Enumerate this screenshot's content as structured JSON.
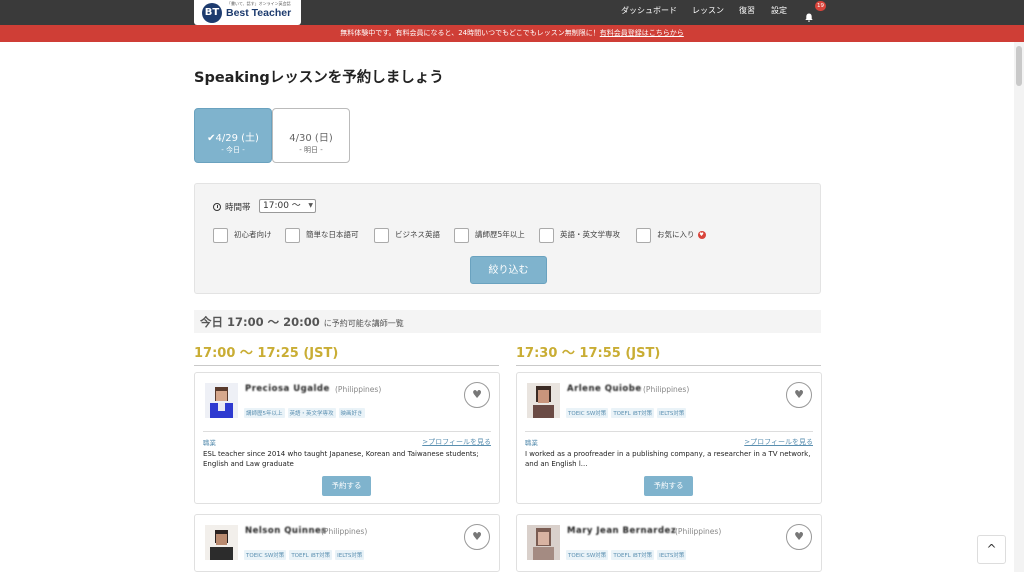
{
  "header": {
    "logo_tagline": "「書いて、話す」オンライン英会話",
    "logo_name": "Best Teacher",
    "nav": [
      "ダッシュボード",
      "レッスン",
      "復習",
      "設定"
    ],
    "notification_count": "19"
  },
  "notice": {
    "text": "無料体験中です。有料会員になると、24時間いつでもどこでもレッスン無制限に！",
    "link": "有料会員登録はこちらから"
  },
  "page_title": "Speakingレッスンを予約しましょう",
  "date_tabs": [
    {
      "date": "4/29 (土)",
      "sub": "- 今日 -",
      "selected": true
    },
    {
      "date": "4/30 (日)",
      "sub": "- 明日 -",
      "selected": false
    }
  ],
  "filter": {
    "time_label": "時間帯",
    "time_value": "17:00 〜",
    "checkboxes": [
      "初心者向け",
      "簡単な日本語可",
      "ビジネス英語",
      "講師歴5年以上",
      "英語・英文学専攻",
      "お気に入り"
    ],
    "apply_label": "絞り込む"
  },
  "available": {
    "prefix": "今日",
    "range": "17:00 〜 20:00",
    "suffix": "に予約可能な講師一覧"
  },
  "slots": [
    "17:00 〜 17:25 (JST)",
    "17:30 〜 17:55 (JST)"
  ],
  "teachers": [
    {
      "name": "Preciosa Ugalde",
      "country": "(Philippines)",
      "tags": [
        "講師歴5年以上",
        "英語・英文学専攻",
        "映画好き"
      ],
      "job_label": "職業",
      "profile_link": ">プロフィールを見る",
      "intro": "ESL teacher since 2014 who taught Japanese, Korean and Taiwanese students; English and Law graduate",
      "book_label": "予約する"
    },
    {
      "name": "Arlene Quiobe",
      "country": "(Philippines)",
      "tags": [
        "TOEIC SW対策",
        "TOEFL iBT対策",
        "IELTS対策"
      ],
      "job_label": "職業",
      "profile_link": ">プロフィールを見る",
      "intro": "I worked as a proofreader in a publishing company, a researcher in a TV network, and an English l...",
      "book_label": "予約する"
    },
    {
      "name": "Nelson Quinnes",
      "country": "(Philippines)",
      "tags": [
        "TOEIC SW対策",
        "TOEFL iBT対策",
        "IELTS対策"
      ]
    },
    {
      "name": "Mary Jean Bernardez",
      "country": "(Philippines)",
      "tags": [
        "TOEIC SW対策",
        "TOEFL iBT対策",
        "IELTS対策"
      ]
    }
  ],
  "to_top": "^"
}
